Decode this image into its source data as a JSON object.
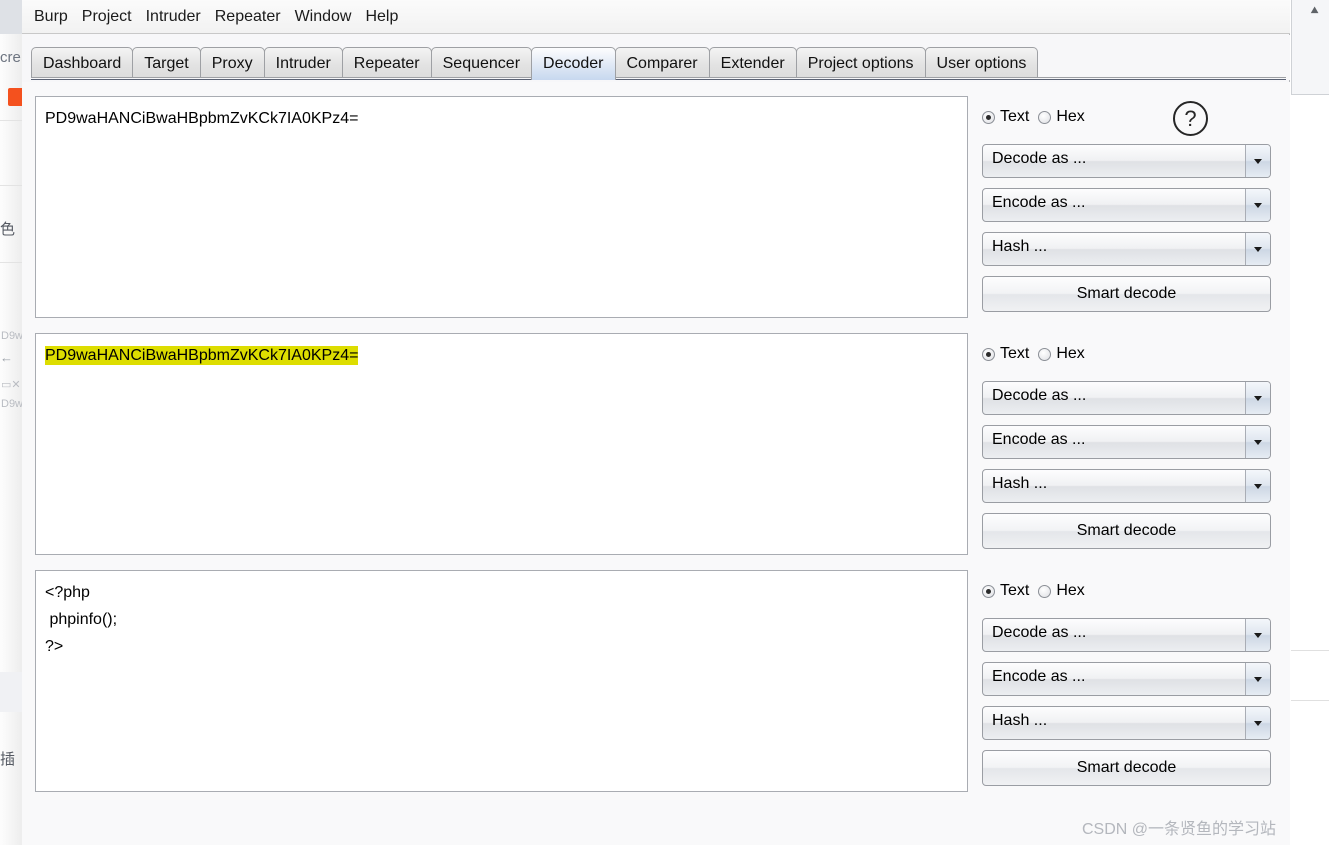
{
  "app": {
    "name": "Burp Suite",
    "menu": [
      "Burp",
      "Project",
      "Intruder",
      "Repeater",
      "Window",
      "Help"
    ],
    "tabs": [
      {
        "label": "Dashboard",
        "selected": false
      },
      {
        "label": "Target",
        "selected": false
      },
      {
        "label": "Proxy",
        "selected": false
      },
      {
        "label": "Intruder",
        "selected": false
      },
      {
        "label": "Repeater",
        "selected": false
      },
      {
        "label": "Sequencer",
        "selected": false
      },
      {
        "label": "Decoder",
        "selected": true
      },
      {
        "label": "Comparer",
        "selected": false
      },
      {
        "label": "Extender",
        "selected": false
      },
      {
        "label": "Project options",
        "selected": false
      },
      {
        "label": "User options",
        "selected": false
      }
    ]
  },
  "decoder": {
    "panels": [
      {
        "id": "panel-input",
        "lines": [
          "PD9waHANCiBwaHBpbmZvKCk7IA0KPz4="
        ],
        "highlighted": false,
        "view_mode": "Text",
        "radio_text": "Text",
        "radio_hex": "Hex",
        "decode_as": "Decode as ...",
        "encode_as": "Encode as ...",
        "hash": "Hash ...",
        "smart_decode": "Smart decode",
        "help": "?"
      },
      {
        "id": "panel-middle",
        "lines": [
          "PD9waHANCiBwaHBpbmZvKCk7IA0KPz4="
        ],
        "highlighted": true,
        "view_mode": "Text",
        "radio_text": "Text",
        "radio_hex": "Hex",
        "decode_as": "Decode as ...",
        "encode_as": "Encode as ...",
        "hash": "Hash ...",
        "smart_decode": "Smart decode",
        "help": ""
      },
      {
        "id": "panel-output",
        "lines": [
          "<?php",
          " phpinfo();",
          "?>"
        ],
        "highlighted": false,
        "view_mode": "Text",
        "radio_text": "Text",
        "radio_hex": "Hex",
        "decode_as": "Decode as ...",
        "encode_as": "Encode as ...",
        "hash": "Hash ...",
        "smart_decode": "Smart decode",
        "help": ""
      }
    ]
  },
  "colors": {
    "highlight": "#dddd00",
    "tab_selected": "#c7d8ef",
    "accent_orange": "#f4511e"
  },
  "background": {
    "fragment_cre": "cre",
    "fragment_cjk_color": "色",
    "fragment_cjk_plugin": "插",
    "fragment_arrow": "←",
    "fragment_tiny": "D9w"
  },
  "watermark": {
    "text": "CSDN @一条贤鱼的学习站"
  }
}
